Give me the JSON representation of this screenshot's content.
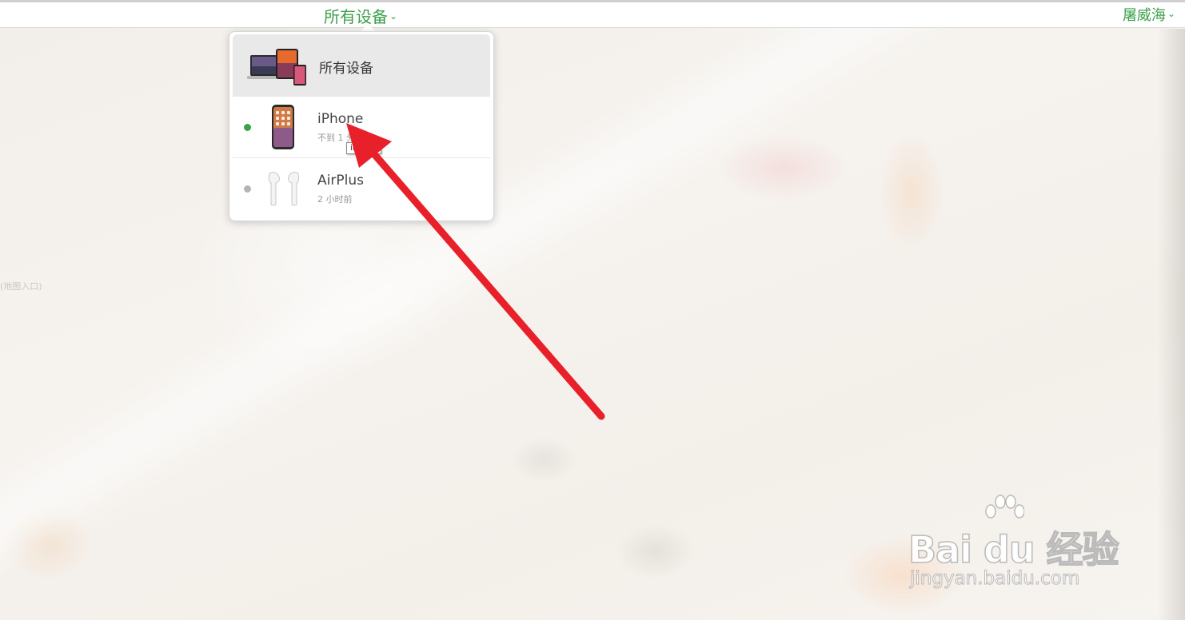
{
  "header": {
    "device_selector_label": "所有设备",
    "account_label": "屠威海"
  },
  "dropdown": {
    "all_devices": {
      "label": "所有设备",
      "icon": "devices-group-icon"
    },
    "devices": [
      {
        "name": "iPhone",
        "status": "不到 1 分钟前",
        "online": true,
        "icon": "iphone-icon"
      },
      {
        "name": "AirPlus",
        "status": "2 小时前",
        "online": false,
        "icon": "airpods-icon"
      }
    ]
  },
  "tooltip": {
    "text": "iPhone"
  },
  "map": {
    "faint_label": "(地图入口)"
  },
  "watermark": {
    "brand": "Bai du 经验",
    "url": "jingyan.baidu.com"
  },
  "colors": {
    "accent": "#3ca14b",
    "online_dot": "#3ca14b",
    "offline_dot": "#b5b5b5",
    "annotation_arrow": "#e8202a"
  }
}
